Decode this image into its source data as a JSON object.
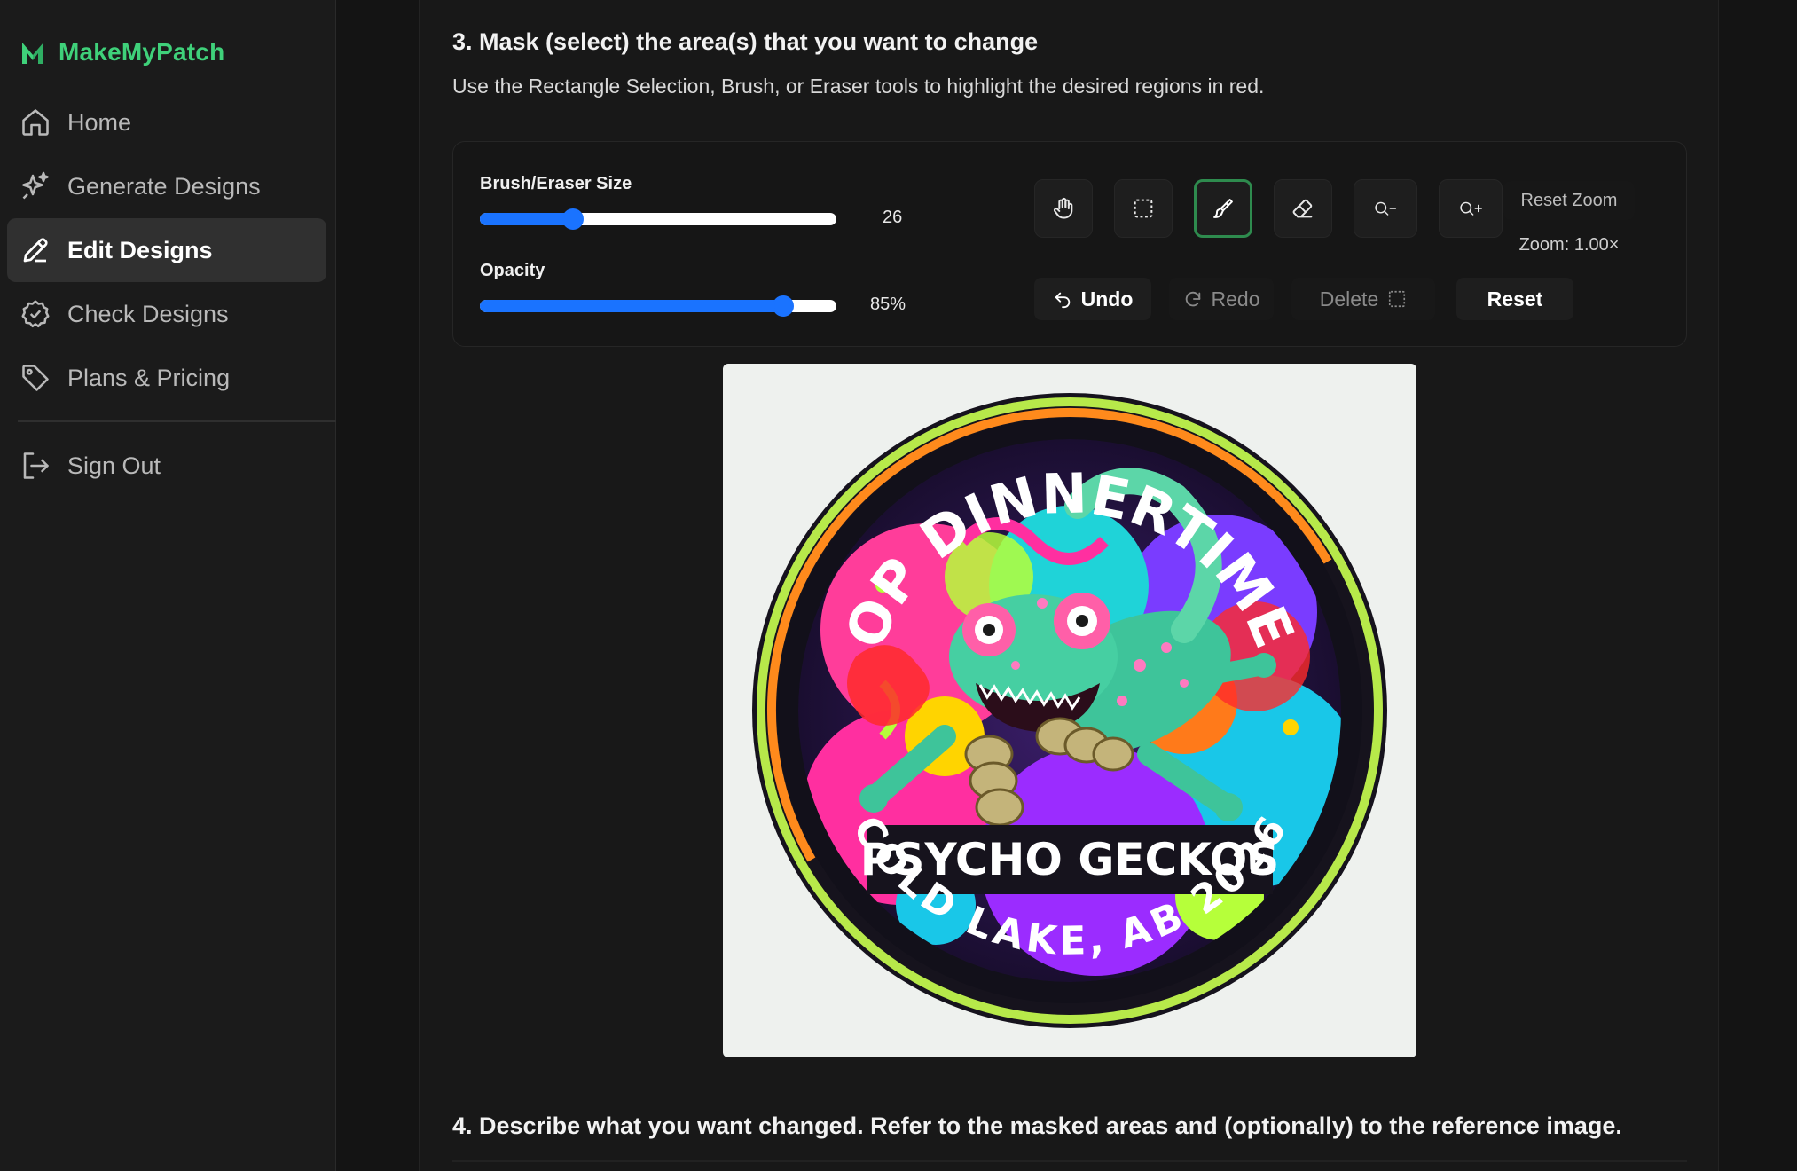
{
  "sidebar": {
    "brand": "MakeMyPatch",
    "items": [
      {
        "label": "Home",
        "icon": "home-icon",
        "active": false
      },
      {
        "label": "Generate Designs",
        "icon": "sparkles-icon",
        "active": false
      },
      {
        "label": "Edit Designs",
        "icon": "pencil-icon",
        "active": true
      },
      {
        "label": "Check Designs",
        "icon": "check-badge-icon",
        "active": false
      },
      {
        "label": "Plans & Pricing",
        "icon": "tag-icon",
        "active": false
      }
    ],
    "signout": "Sign Out"
  },
  "step3": {
    "title": "3. Mask (select) the area(s) that you want to change",
    "description": "Use the Rectangle Selection, Brush, or Eraser tools to highlight the desired regions in red."
  },
  "toolbar": {
    "brush_label": "Brush/Eraser Size",
    "brush_value": "26",
    "brush_fraction": 0.26,
    "opacity_label": "Opacity",
    "opacity_value": "85%",
    "opacity_fraction": 0.85,
    "tools": [
      "hand-icon",
      "rectangle-select-icon",
      "brush-icon",
      "eraser-icon",
      "zoom-out-icon",
      "zoom-in-icon"
    ],
    "active_tool": "brush-icon",
    "reset_zoom_label": "Reset Zoom",
    "zoom_label": "Zoom: 1.00×",
    "undo_label": "Undo",
    "redo_label": "Redo",
    "delete_label": "Delete",
    "reset_label": "Reset"
  },
  "patch": {
    "top_text": "OP DINNERTIME",
    "banner_text": "PSYCHO GECKOS",
    "bottom_text": "COLD LAKE, AB 2026"
  },
  "step4": {
    "title": "4. Describe what you want changed. Refer to the masked areas and (optionally) to the reference image."
  },
  "colors": {
    "brand": "#3fd17a",
    "accent": "#1a73ff",
    "active_tool_border": "#2e8b4e"
  }
}
